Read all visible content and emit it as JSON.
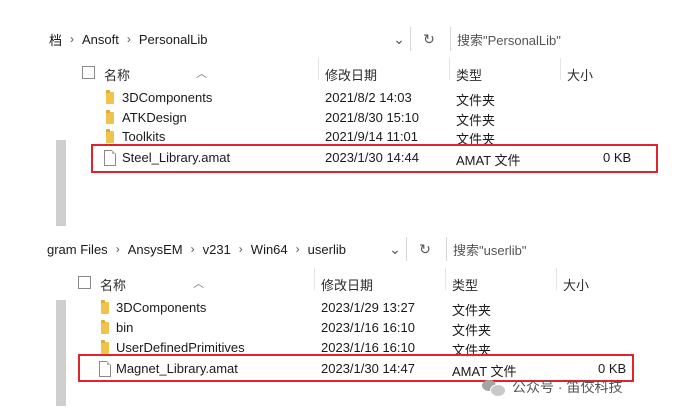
{
  "top_window": {
    "breadcrumb": {
      "partial": "档",
      "items": [
        "Ansoft",
        "PersonalLib"
      ]
    },
    "search_placeholder": "搜索\"PersonalLib\"",
    "columns": {
      "name": "名称",
      "modified": "修改日期",
      "type": "类型",
      "size": "大小"
    },
    "rows": [
      {
        "name": "3DComponents",
        "modified": "2021/8/2 14:03",
        "type": "文件夹",
        "size": "",
        "kind": "folder"
      },
      {
        "name": "ATKDesign",
        "modified": "2021/8/30 15:10",
        "type": "文件夹",
        "size": "",
        "kind": "folder"
      },
      {
        "name": "Toolkits",
        "modified": "2021/9/14 11:01",
        "type": "文件夹",
        "size": "",
        "kind": "folder"
      },
      {
        "name": "Steel_Library.amat",
        "modified": "2023/1/30 14:44",
        "type": "AMAT 文件",
        "size": "0 KB",
        "kind": "file",
        "highlighted": true
      }
    ]
  },
  "bottom_window": {
    "breadcrumb": {
      "partial": "gram Files",
      "items": [
        "AnsysEM",
        "v231",
        "Win64",
        "userlib"
      ]
    },
    "search_placeholder": "搜索\"userlib\"",
    "columns": {
      "name": "名称",
      "modified": "修改日期",
      "type": "类型",
      "size": "大小"
    },
    "rows": [
      {
        "name": "3DComponents",
        "modified": "2023/1/29 13:27",
        "type": "文件夹",
        "size": "",
        "kind": "folder"
      },
      {
        "name": "bin",
        "modified": "2023/1/16 16:10",
        "type": "文件夹",
        "size": "",
        "kind": "folder"
      },
      {
        "name": "UserDefinedPrimitives",
        "modified": "2023/1/16 16:10",
        "type": "文件夹",
        "size": "",
        "kind": "folder"
      },
      {
        "name": "Magnet_Library.amat",
        "modified": "2023/1/30 14:47",
        "type": "AMAT 文件",
        "size": "0 KB",
        "kind": "file",
        "highlighted": true
      }
    ]
  },
  "watermark": {
    "text": "公众号 · 笛佼科技"
  },
  "colors": {
    "highlight": "#e0242e",
    "folder": "#f0c34a"
  }
}
